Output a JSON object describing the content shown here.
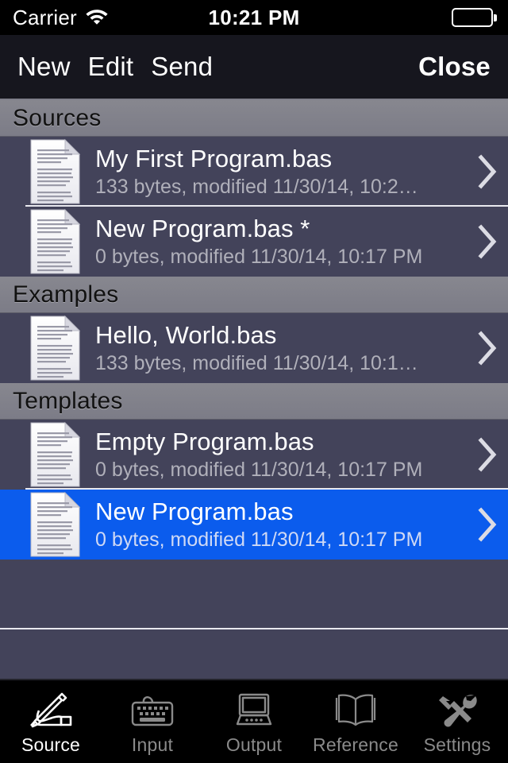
{
  "status_bar": {
    "carrier": "Carrier",
    "wifi_icon": "wifi-icon",
    "time": "10:21 PM",
    "battery_icon": "battery-full-icon"
  },
  "nav_bar": {
    "new_label": "New",
    "edit_label": "Edit",
    "send_label": "Send",
    "close_label": "Close"
  },
  "colors": {
    "row_background": "#43435a",
    "selected_row": "#0b5ced",
    "section_header": "#7e7e88",
    "navbar": "#16161e",
    "tabbar": "#000000",
    "title_text": "#ffffff",
    "subtitle_text": "#b0b0ba"
  },
  "sections": [
    {
      "header": "Sources",
      "rows": [
        {
          "icon": "document-icon",
          "title": "My First Program.bas",
          "subtitle": "133 bytes, modified 11/30/14, 10:2…",
          "accessory": "chevron-right-icon",
          "selected": false
        },
        {
          "icon": "document-icon",
          "title": "New Program.bas *",
          "subtitle": "0 bytes, modified 11/30/14, 10:17 PM",
          "accessory": "chevron-right-icon",
          "selected": false
        }
      ]
    },
    {
      "header": "Examples",
      "rows": [
        {
          "icon": "document-icon",
          "title": "Hello, World.bas",
          "subtitle": "133 bytes, modified 11/30/14, 10:1…",
          "accessory": "chevron-right-icon",
          "selected": false
        }
      ]
    },
    {
      "header": "Templates",
      "rows": [
        {
          "icon": "document-icon",
          "title": "Empty Program.bas",
          "subtitle": "0 bytes, modified 11/30/14, 10:17 PM",
          "accessory": "chevron-right-icon",
          "selected": false
        },
        {
          "icon": "document-icon",
          "title": "New Program.bas",
          "subtitle": "0 bytes, modified 11/30/14, 10:17 PM",
          "accessory": "chevron-right-icon",
          "selected": true
        }
      ]
    }
  ],
  "tab_bar": {
    "items": [
      {
        "label": "Source",
        "icon": "writing-hand-icon",
        "active": true
      },
      {
        "label": "Input",
        "icon": "keyboard-icon",
        "active": false
      },
      {
        "label": "Output",
        "icon": "computer-icon",
        "active": false
      },
      {
        "label": "Reference",
        "icon": "open-book-icon",
        "active": false
      },
      {
        "label": "Settings",
        "icon": "tools-icon",
        "active": false
      }
    ]
  }
}
